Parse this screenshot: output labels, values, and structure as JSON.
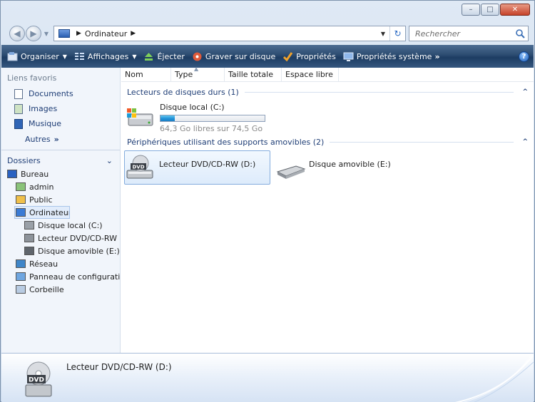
{
  "titlebar": {
    "minimize": "–",
    "maximize": "□",
    "close": "✕"
  },
  "address": {
    "crumbs": [
      "Ordinateur"
    ],
    "search_placeholder": "Rechercher"
  },
  "toolbar": {
    "items": [
      {
        "label": "Organiser",
        "icon": "organize-icon",
        "dropdown": true
      },
      {
        "label": "Affichages",
        "icon": "views-icon",
        "dropdown": true
      },
      {
        "label": "Éjecter",
        "icon": "eject-icon",
        "dropdown": false
      },
      {
        "label": "Graver sur disque",
        "icon": "burn-disc-icon",
        "dropdown": false
      },
      {
        "label": "Propriétés",
        "icon": "properties-icon",
        "dropdown": false
      },
      {
        "label": "Propriétés système",
        "icon": "system-properties-icon",
        "dropdown": false
      }
    ],
    "more": "»",
    "help": "?"
  },
  "nav": {
    "favorites_title": "Liens favoris",
    "favorites": [
      "Documents",
      "Images",
      "Musique"
    ],
    "more_label": "Autres",
    "more_chevron": "»",
    "folders_title": "Dossiers",
    "folders_chevron": "⌄",
    "tree": [
      {
        "label": "Bureau",
        "indent": 0,
        "icon": "desktop-icon"
      },
      {
        "label": "admin",
        "indent": 1,
        "icon": "user-folder-icon"
      },
      {
        "label": "Public",
        "indent": 1,
        "icon": "folder-icon"
      },
      {
        "label": "Ordinateur",
        "indent": 1,
        "icon": "computer-icon",
        "selected": true
      },
      {
        "label": "Disque local (C:)",
        "indent": 2,
        "icon": "local-disk-icon"
      },
      {
        "label": "Lecteur DVD/CD-RW (D:)",
        "indent": 2,
        "icon": "dvd-drive-icon"
      },
      {
        "label": "Disque amovible (E:)",
        "indent": 2,
        "icon": "removable-disk-icon"
      },
      {
        "label": "Réseau",
        "indent": 1,
        "icon": "network-icon"
      },
      {
        "label": "Panneau de configuration",
        "indent": 1,
        "icon": "control-panel-icon"
      },
      {
        "label": "Corbeille",
        "indent": 1,
        "icon": "recycle-bin-icon"
      }
    ]
  },
  "columns": [
    "Nom",
    "Type",
    "Taille totale",
    "Espace libre"
  ],
  "groups": {
    "hard_disks": {
      "title": "Lecteurs de disques durs (1)",
      "drive": {
        "name": "Disque local (C:)",
        "free_text": "64,3 Go libres sur 74,5 Go",
        "used_fraction": 0.14
      }
    },
    "removable": {
      "title": "Périphériques utilisant des supports amovibles (2)",
      "items": [
        {
          "name": "Lecteur DVD/CD-RW (D:)",
          "selected": true,
          "icon": "dvd-drive-icon"
        },
        {
          "name": "Disque amovible (E:)",
          "selected": false,
          "icon": "removable-disk-icon"
        }
      ]
    }
  },
  "details": {
    "name": "Lecteur DVD/CD-RW (D:)",
    "icon_label": "DVD"
  },
  "colors": {
    "toolbar": "#2b4b70",
    "link": "#1f3e76",
    "selection": "#ddebfb",
    "usage_fill": "#2192d8"
  }
}
